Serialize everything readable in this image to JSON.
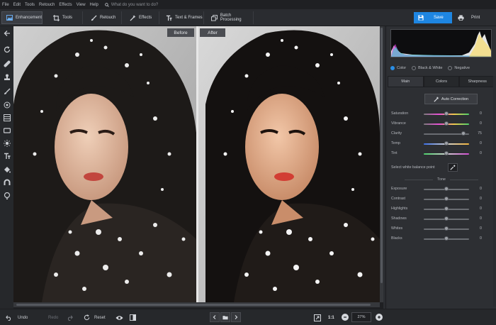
{
  "menu": {
    "items": [
      "File",
      "Edit",
      "Tools",
      "Retouch",
      "Effects",
      "View",
      "Help"
    ],
    "search_placeholder": "What do you want to do?"
  },
  "toolbar": {
    "tabs": [
      {
        "label": "Enhancement",
        "icon": "enhancement-icon"
      },
      {
        "label": "Tools",
        "icon": "crop-icon"
      },
      {
        "label": "Retouch",
        "icon": "brush-icon"
      },
      {
        "label": "Effects",
        "icon": "magic-wand-icon"
      },
      {
        "label": "Text & Frames",
        "icon": "text-icon"
      },
      {
        "label": "Batch Processing",
        "icon": "batch-icon"
      }
    ],
    "save_label": "Save",
    "print_label": "Print",
    "accent": "#1e86e2"
  },
  "canvas": {
    "before_label": "Before",
    "after_label": "After"
  },
  "panel": {
    "modes": [
      "Color",
      "Black & White",
      "Negative"
    ],
    "selected_mode": "Color",
    "tabs": [
      "Main",
      "Colors",
      "Sharpness"
    ],
    "active_tab": "Main",
    "auto_correction": "Auto Correction",
    "main_sliders": [
      {
        "label": "Saturation",
        "value": "0",
        "position": 0.5
      },
      {
        "label": "Vibrance",
        "value": "0",
        "position": 0.5
      },
      {
        "label": "Clarity",
        "value": "75",
        "position": 0.88
      },
      {
        "label": "Temp",
        "value": "0",
        "position": 0.5
      },
      {
        "label": "Tint",
        "value": "0",
        "position": 0.5
      }
    ],
    "white_balance_label": "Select white balance point",
    "tone_label": "Tone",
    "tone_sliders": [
      {
        "label": "Exposure",
        "value": "0",
        "position": 0.5
      },
      {
        "label": "Contrast",
        "value": "0",
        "position": 0.5
      },
      {
        "label": "Highlights",
        "value": "0",
        "position": 0.5
      },
      {
        "label": "Shadows",
        "value": "0",
        "position": 0.5
      },
      {
        "label": "Whites",
        "value": "0",
        "position": 0.5
      },
      {
        "label": "Blacks",
        "value": "0",
        "position": 0.5
      }
    ]
  },
  "bottom": {
    "undo_label": "Undo",
    "redo_label": "Redo",
    "reset_label": "Reset",
    "fit_label": "1:1",
    "zoom_value": "27%"
  }
}
